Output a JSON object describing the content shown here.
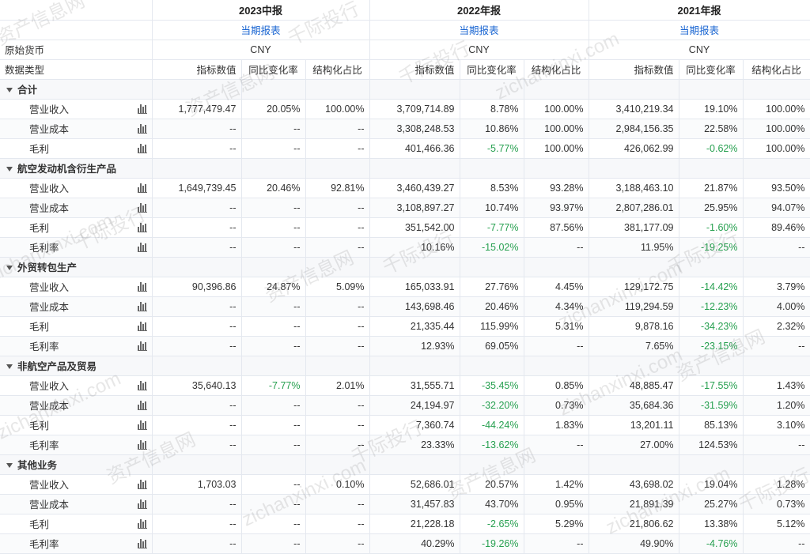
{
  "header": {
    "years": [
      "2023中报",
      "2022年报",
      "2021年报"
    ],
    "report_link": "当期报表",
    "currency_label": "原始货币",
    "currency": "CNY",
    "data_type_label": "数据类型",
    "metrics": [
      "指标数值",
      "同比变化率",
      "结构化占比"
    ]
  },
  "watermark": [
    "资产信息网",
    "千际投行",
    "zichanxinxi.com"
  ],
  "sections": [
    {
      "name": "合计",
      "rows": [
        {
          "label": "营业收入",
          "cells": [
            "1,777,479.47",
            "20.05%",
            "100.00%",
            "3,709,714.89",
            "8.78%",
            "100.00%",
            "3,410,219.34",
            "19.10%",
            "100.00%"
          ]
        },
        {
          "label": "营业成本",
          "cells": [
            "--",
            "--",
            "--",
            "3,308,248.53",
            "10.86%",
            "100.00%",
            "2,984,156.35",
            "22.58%",
            "100.00%"
          ]
        },
        {
          "label": "毛利",
          "cells": [
            "--",
            "--",
            "--",
            "401,466.36",
            "-5.77%",
            "100.00%",
            "426,062.99",
            "-0.62%",
            "100.00%"
          ]
        }
      ]
    },
    {
      "name": "航空发动机含衍生产品",
      "rows": [
        {
          "label": "营业收入",
          "cells": [
            "1,649,739.45",
            "20.46%",
            "92.81%",
            "3,460,439.27",
            "8.53%",
            "93.28%",
            "3,188,463.10",
            "21.87%",
            "93.50%"
          ]
        },
        {
          "label": "营业成本",
          "cells": [
            "--",
            "--",
            "--",
            "3,108,897.27",
            "10.74%",
            "93.97%",
            "2,807,286.01",
            "25.95%",
            "94.07%"
          ]
        },
        {
          "label": "毛利",
          "cells": [
            "--",
            "--",
            "--",
            "351,542.00",
            "-7.77%",
            "87.56%",
            "381,177.09",
            "-1.60%",
            "89.46%"
          ]
        },
        {
          "label": "毛利率",
          "cells": [
            "--",
            "--",
            "--",
            "10.16%",
            "-15.02%",
            "--",
            "11.95%",
            "-19.25%",
            "--"
          ]
        }
      ]
    },
    {
      "name": "外贸转包生产",
      "rows": [
        {
          "label": "营业收入",
          "cells": [
            "90,396.86",
            "24.87%",
            "5.09%",
            "165,033.91",
            "27.76%",
            "4.45%",
            "129,172.75",
            "-14.42%",
            "3.79%"
          ]
        },
        {
          "label": "营业成本",
          "cells": [
            "--",
            "--",
            "--",
            "143,698.46",
            "20.46%",
            "4.34%",
            "119,294.59",
            "-12.23%",
            "4.00%"
          ]
        },
        {
          "label": "毛利",
          "cells": [
            "--",
            "--",
            "--",
            "21,335.44",
            "115.99%",
            "5.31%",
            "9,878.16",
            "-34.23%",
            "2.32%"
          ]
        },
        {
          "label": "毛利率",
          "cells": [
            "--",
            "--",
            "--",
            "12.93%",
            "69.05%",
            "--",
            "7.65%",
            "-23.15%",
            "--"
          ]
        }
      ]
    },
    {
      "name": "非航空产品及贸易",
      "rows": [
        {
          "label": "营业收入",
          "cells": [
            "35,640.13",
            "-7.77%",
            "2.01%",
            "31,555.71",
            "-35.45%",
            "0.85%",
            "48,885.47",
            "-17.55%",
            "1.43%"
          ]
        },
        {
          "label": "营业成本",
          "cells": [
            "--",
            "--",
            "--",
            "24,194.97",
            "-32.20%",
            "0.73%",
            "35,684.36",
            "-31.59%",
            "1.20%"
          ]
        },
        {
          "label": "毛利",
          "cells": [
            "--",
            "--",
            "--",
            "7,360.74",
            "-44.24%",
            "1.83%",
            "13,201.11",
            "85.13%",
            "3.10%"
          ]
        },
        {
          "label": "毛利率",
          "cells": [
            "--",
            "--",
            "--",
            "23.33%",
            "-13.62%",
            "--",
            "27.00%",
            "124.53%",
            "--"
          ]
        }
      ]
    },
    {
      "name": "其他业务",
      "rows": [
        {
          "label": "营业收入",
          "cells": [
            "1,703.03",
            "--",
            "0.10%",
            "52,686.01",
            "20.57%",
            "1.42%",
            "43,698.02",
            "19.04%",
            "1.28%"
          ]
        },
        {
          "label": "营业成本",
          "cells": [
            "--",
            "--",
            "--",
            "31,457.83",
            "43.70%",
            "0.95%",
            "21,891.39",
            "25.27%",
            "0.73%"
          ]
        },
        {
          "label": "毛利",
          "cells": [
            "--",
            "--",
            "--",
            "21,228.18",
            "-2.65%",
            "5.29%",
            "21,806.62",
            "13.38%",
            "5.12%"
          ]
        },
        {
          "label": "毛利率",
          "cells": [
            "--",
            "--",
            "--",
            "40.29%",
            "-19.26%",
            "--",
            "49.90%",
            "-4.76%",
            "--"
          ]
        }
      ]
    }
  ]
}
